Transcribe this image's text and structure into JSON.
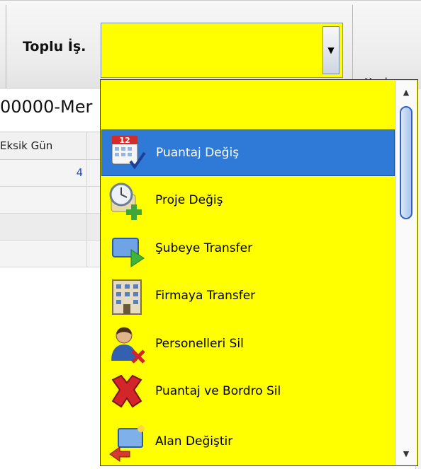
{
  "toolbar": {
    "bulk_label": "Toplu İş.",
    "help_label": "Yardım",
    "combo_value": ""
  },
  "grid": {
    "title": "00000-Mer",
    "column_header": "Eksik Gün",
    "rows": [
      "4",
      "",
      "",
      ""
    ]
  },
  "dropdown": {
    "items": [
      {
        "label": "Puantaj Değiş",
        "icon": "calendar-check-icon",
        "selected": true
      },
      {
        "label": "Proje Değiş",
        "icon": "clock-add-icon",
        "selected": false
      },
      {
        "label": "Şubeye Transfer",
        "icon": "monitor-transfer-icon",
        "selected": false
      },
      {
        "label": "Firmaya Transfer",
        "icon": "building-icon",
        "selected": false
      },
      {
        "label": "Personelleri Sil",
        "icon": "user-delete-icon",
        "selected": false
      },
      {
        "label": "Puantaj ve Bordro Sil",
        "icon": "red-x-icon",
        "selected": false
      },
      {
        "label": "Alan Değiştir",
        "icon": "field-swap-icon",
        "selected": false
      }
    ]
  },
  "colors": {
    "dropdown_bg": "#ffff00",
    "selection": "#2f7ad6",
    "number": "#1f4fd6"
  }
}
